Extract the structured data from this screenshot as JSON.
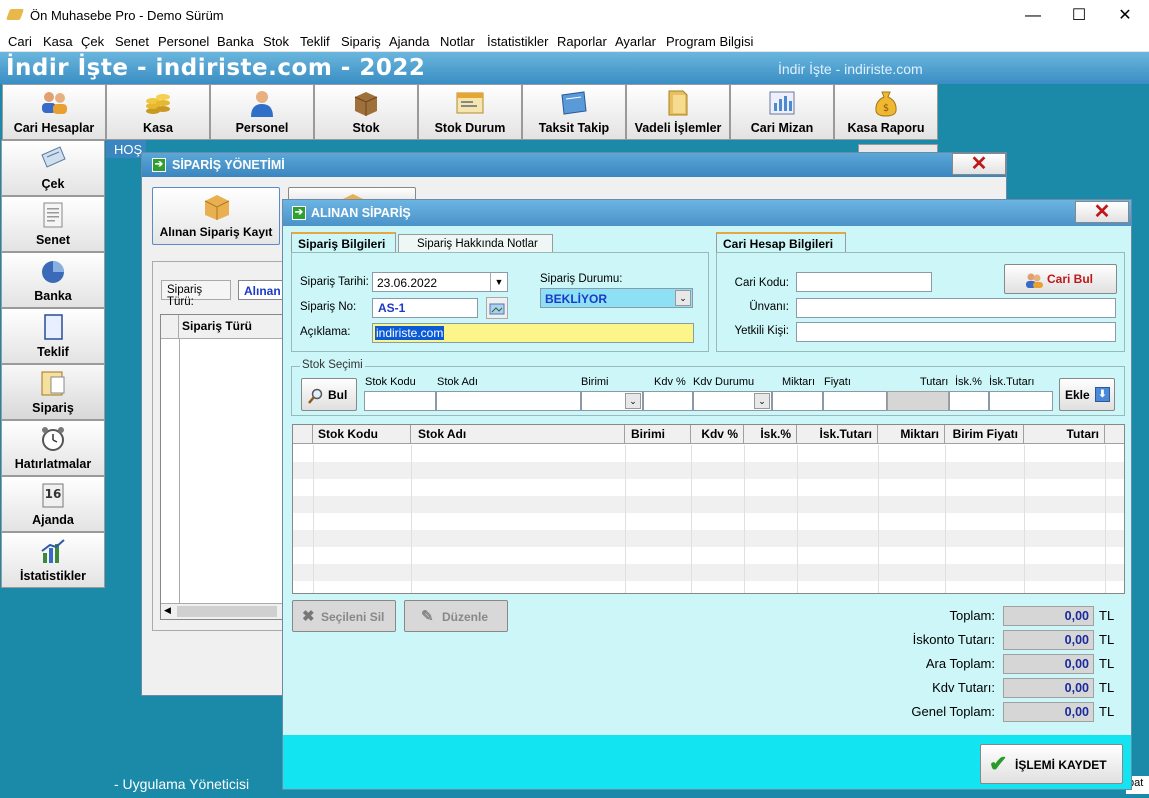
{
  "window": {
    "title": "Ön Muhasebe Pro - Demo Sürüm"
  },
  "menu": [
    "Cari",
    "Kasa",
    "Çek",
    "Senet",
    "Personel",
    "Banka",
    "Stok",
    "Teklif",
    "Sipariş",
    "Ajanda",
    "Notlar",
    "İstatistikler",
    "Raporlar",
    "Ayarlar",
    "Program Bilgisi"
  ],
  "banner": {
    "title": "İndir İşte - indiriste.com - 2022",
    "subtitle": "İndir İşte - indiriste.com"
  },
  "toolbar": [
    "Cari Hesaplar",
    "Kasa",
    "Personel",
    "Stok",
    "Stok Durum",
    "Taksit Takip",
    "Vadeli İşlemler",
    "Cari Mizan",
    "Kasa Raporu"
  ],
  "sidebar": [
    "Çek",
    "Senet",
    "Banka",
    "Teklif",
    "Sipariş",
    "Hatırlatmalar",
    "Ajanda",
    "İstatistikler"
  ],
  "behind_label": "HOŞ",
  "status_left": "- Uygulama Yöneticisi",
  "status_right": "pat",
  "siparis_yonetimi": {
    "title": "SİPARİŞ YÖNETİMİ",
    "alinan_kayit": "Alınan Sipariş Kayıt",
    "siparis_turu_label": "Sipariş Türü:",
    "siparis_turu_value": "Alınan",
    "grid_header": "Sipariş Türü"
  },
  "alinan_siparis": {
    "title": "ALINAN SİPARİŞ",
    "tabs": [
      "Sipariş Bilgileri",
      "Sipariş Hakkında Notlar"
    ],
    "cari_tab": "Cari Hesap Bilgileri",
    "tarih_label": "Sipariş Tarihi:",
    "tarih_value": "23.06.2022",
    "no_label": "Sipariş No:",
    "no_value": "AS-1",
    "aciklama_label": "Açıklama:",
    "aciklama_value": "indiriste.com",
    "durum_label": "Sipariş Durumu:",
    "durum_value": "BEKLİYOR",
    "cari_kodu_label": "Cari Kodu:",
    "unvan_label": "Ünvanı:",
    "yetkili_label": "Yetkili Kişi:",
    "cari_bul": "Cari Bul",
    "stok_secimi": "Stok Seçimi",
    "bul": "Bul",
    "ekle": "Ekle",
    "stok_fields": [
      "Stok Kodu",
      "Stok Adı",
      "Birimi",
      "Kdv %",
      "Kdv Durumu",
      "Miktarı",
      "Fiyatı",
      "Tutarı",
      "İsk.%",
      "İsk.Tutarı"
    ],
    "columns": [
      "Stok Kodu",
      "Stok Adı",
      "Birimi",
      "Kdv %",
      "İsk.%",
      "İsk.Tutarı",
      "Miktarı",
      "Birim Fiyatı",
      "Tutarı"
    ],
    "secileni_sil": "Seçileni Sil",
    "duzenle": "Düzenle",
    "totals": [
      {
        "label": "Toplam:",
        "value": "0,00",
        "unit": "TL"
      },
      {
        "label": "İskonto Tutarı:",
        "value": "0,00",
        "unit": "TL"
      },
      {
        "label": "Ara Toplam:",
        "value": "0,00",
        "unit": "TL"
      },
      {
        "label": "Kdv Tutarı:",
        "value": "0,00",
        "unit": "TL"
      },
      {
        "label": "Genel Toplam:",
        "value": "0,00",
        "unit": "TL"
      }
    ],
    "kaydet": "İŞLEMİ KAYDET"
  }
}
